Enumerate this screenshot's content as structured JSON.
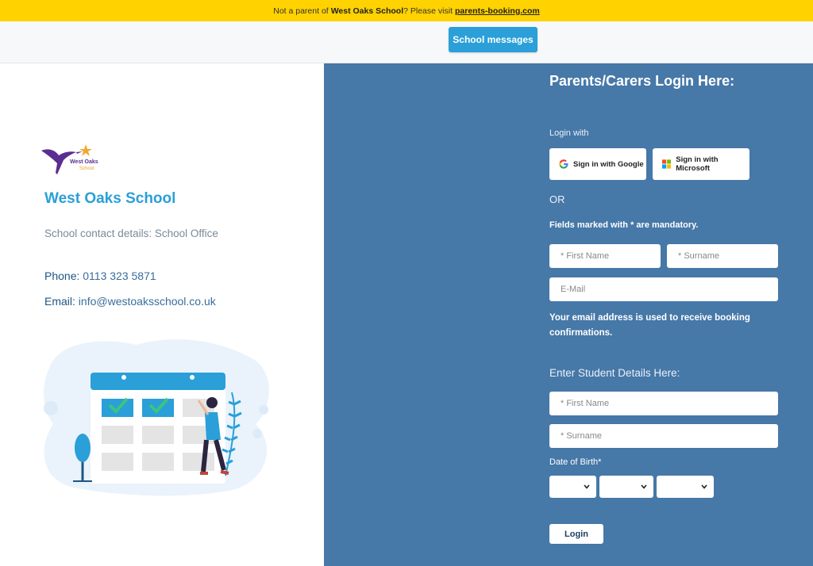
{
  "topbar": {
    "prefix": "Not a parent of",
    "school": "West Oaks School",
    "middle": "? Please visit",
    "link": "parents-booking.com"
  },
  "navbar": {
    "messages_button": "School messages"
  },
  "school": {
    "logo_text_line1": "West Oaks",
    "logo_text_line2": "School",
    "name": "West Oaks School",
    "contact": "School contact details: School Office",
    "phone_label": "Phone:",
    "phone": "0113 323 5871",
    "email_label": "Email:",
    "email": "info@westoaksschool.co.uk"
  },
  "login": {
    "title": "Parents/Carers Login Here:",
    "login_with": "Login with",
    "google_button": "Sign in with Google",
    "microsoft_button": "Sign in with Microsoft",
    "or": "OR",
    "mandatory_note": "Fields marked with * are mandatory.",
    "first_name_placeholder": "* First Name",
    "surname_placeholder": "* Surname",
    "email_placeholder": "E-Mail",
    "email_note": "Your email address is used to receive booking confirmations.",
    "student_title": "Enter Student Details Here:",
    "student_first_name_placeholder": "* First Name",
    "student_surname_placeholder": "* Surname",
    "dob_label": "Date of Birth*",
    "login_button": "Login"
  },
  "colors": {
    "topbar": "#ffd200",
    "accent": "#2a9fd8",
    "panel": "#4678a8"
  }
}
